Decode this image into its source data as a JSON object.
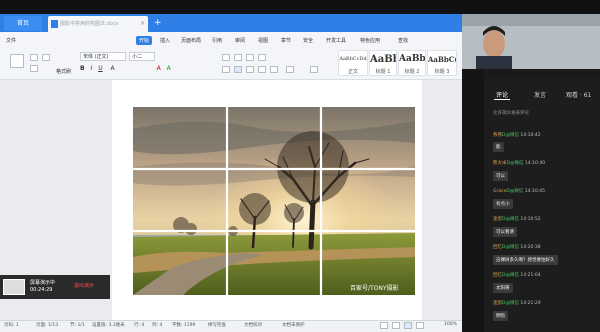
{
  "tabs": {
    "home": "首页",
    "doc": "摄影中常用的构图法.docx"
  },
  "menu": [
    "文件",
    "开始",
    "插入",
    "页面布局",
    "引用",
    "审阅",
    "视图",
    "章节",
    "安全",
    "开发工具",
    "特色应用",
    "查找"
  ],
  "font": {
    "name": "宋体 (正文)",
    "size": "小二"
  },
  "format_label": "格式刷",
  "styles": [
    {
      "sample": "AaBbCcDd",
      "label": "正文"
    },
    {
      "sample": "AaBb",
      "label": "标题 1"
    },
    {
      "sample": "AaBb(",
      "label": "标题 2"
    },
    {
      "sample": "AaBbC(",
      "label": "标题 3"
    }
  ],
  "watermark": "百家号/TONY摄影",
  "share": {
    "title": "屏幕演示中",
    "time": "00:24:29",
    "stop": "退出演示"
  },
  "status": {
    "page": "页码: 1",
    "pages": "页面: 1/13",
    "section": "节: 1/1",
    "setting": "设置值: 3.3厘米",
    "row": "行: 4",
    "col": "列: 4",
    "words": "字数: 1199",
    "spell": "拼写检查",
    "doc_check": "文档校对",
    "protect": "文档未保护",
    "zoom": "100%"
  },
  "right_panel": {
    "tabs": [
      "评论",
      "发言",
      "观看 · 61"
    ],
    "hint": "允许观众发表评论",
    "messages": [
      {
        "name": "燕燕",
        "tag": "D@微信",
        "time": "14:10:42",
        "text": "能"
      },
      {
        "name": "熊大米",
        "tag": "D@微信",
        "time": "14:10:40",
        "text": "可以"
      },
      {
        "name": "Grace",
        "tag": "D@微信",
        "time": "14:10:45",
        "text": "有点小"
      },
      {
        "name": "迷思",
        "tag": "D@微信",
        "time": "14:10:52",
        "text": "可以看清"
      },
      {
        "name": "回忆",
        "tag": "D@微信",
        "time": "14:20:38",
        "text": "这裸树多久啊？感觉要怕好久"
      },
      {
        "name": "回忆",
        "tag": "D@微信",
        "time": "14:21:04",
        "text": "太阳黄"
      },
      {
        "name": "迷思",
        "tag": "D@微信",
        "time": "14:21:29",
        "text": "明暗"
      }
    ]
  }
}
